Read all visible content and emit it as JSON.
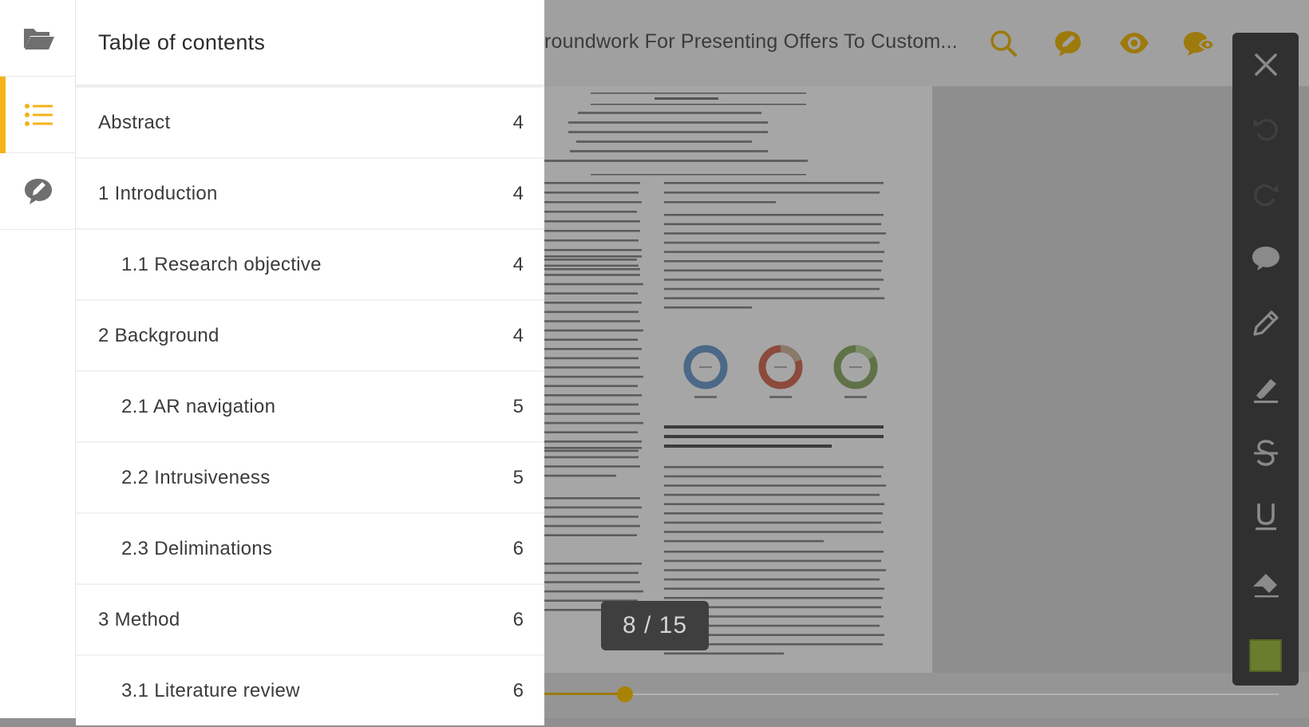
{
  "reader": {
    "title": "roundwork For Presenting Offers To Custom...",
    "page_counter": "8 / 15",
    "progress": 0.11,
    "top_icons": [
      "search-icon",
      "comment-edit-icon",
      "eye-icon",
      "hide-annotations-icon"
    ]
  },
  "annotation_tools": [
    "close-icon",
    "undo-icon",
    "redo-icon",
    "comment-icon",
    "pen-icon",
    "highlighter-icon",
    "strikethrough-icon",
    "underline-icon",
    "eraser-icon"
  ],
  "annotation_color": "#6a7d2f",
  "rail": {
    "items": [
      {
        "icon": "folder-open-icon",
        "active": false
      },
      {
        "icon": "list-icon",
        "active": true
      },
      {
        "icon": "annotations-icon",
        "active": false
      }
    ],
    "accent": "#f4b31a"
  },
  "toc": {
    "title": "Table of contents",
    "items": [
      {
        "label": "Abstract",
        "page": "4",
        "level": 0
      },
      {
        "label": "1 Introduction",
        "page": "4",
        "level": 0
      },
      {
        "label": "1.1 Research objective",
        "page": "4",
        "level": 1
      },
      {
        "label": "2 Background",
        "page": "4",
        "level": 0
      },
      {
        "label": "2.1 AR navigation",
        "page": "5",
        "level": 1
      },
      {
        "label": "2.2 Intrusiveness",
        "page": "5",
        "level": 1
      },
      {
        "label": "2.3 Deliminations",
        "page": "6",
        "level": 1
      },
      {
        "label": "3 Method",
        "page": "6",
        "level": 0
      },
      {
        "label": "3.1 Literature review",
        "page": "6",
        "level": 1
      }
    ]
  }
}
